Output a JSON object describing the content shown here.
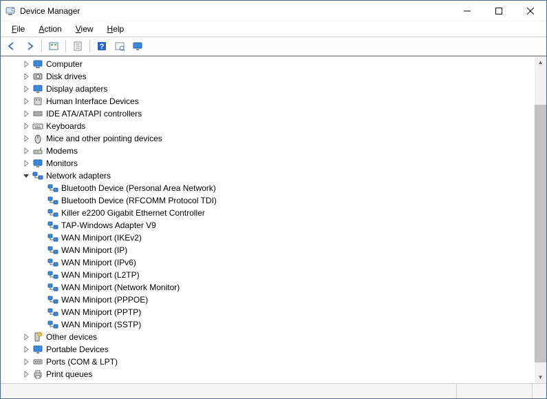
{
  "window": {
    "title": "Device Manager"
  },
  "menubar": {
    "file": {
      "label": "File",
      "accel": "F"
    },
    "action": {
      "label": "Action",
      "accel": "A"
    },
    "view": {
      "label": "View",
      "accel": "V"
    },
    "help": {
      "label": "Help",
      "accel": "H"
    }
  },
  "toolbar": {
    "back": "back-icon",
    "forward": "forward-icon",
    "show_hidden": "show-hidden-icon",
    "properties": "properties-icon",
    "help": "help-icon",
    "scan": "scan-icon",
    "monitor": "monitor-icon"
  },
  "tree": {
    "categories": [
      {
        "id": "computer",
        "label": "Computer",
        "expanded": false,
        "svg": "computer"
      },
      {
        "id": "disk-drives",
        "label": "Disk drives",
        "expanded": false,
        "svg": "disk"
      },
      {
        "id": "display-adapters",
        "label": "Display adapters",
        "expanded": false,
        "svg": "display"
      },
      {
        "id": "hid",
        "label": "Human Interface Devices",
        "expanded": false,
        "svg": "hid"
      },
      {
        "id": "ide",
        "label": "IDE ATA/ATAPI controllers",
        "expanded": false,
        "svg": "ide"
      },
      {
        "id": "keyboards",
        "label": "Keyboards",
        "expanded": false,
        "svg": "keyboard"
      },
      {
        "id": "mice",
        "label": "Mice and other pointing devices",
        "expanded": false,
        "svg": "mouse"
      },
      {
        "id": "modems",
        "label": "Modems",
        "expanded": false,
        "svg": "modem"
      },
      {
        "id": "monitors",
        "label": "Monitors",
        "expanded": false,
        "svg": "monitor"
      },
      {
        "id": "network",
        "label": "Network adapters",
        "expanded": true,
        "svg": "network",
        "children": [
          {
            "label": "Bluetooth Device (Personal Area Network)"
          },
          {
            "label": "Bluetooth Device (RFCOMM Protocol TDI)"
          },
          {
            "label": "Killer e2200 Gigabit Ethernet Controller"
          },
          {
            "label": "TAP-Windows Adapter V9"
          },
          {
            "label": "WAN Miniport (IKEv2)"
          },
          {
            "label": "WAN Miniport (IP)"
          },
          {
            "label": "WAN Miniport (IPv6)"
          },
          {
            "label": "WAN Miniport (L2TP)"
          },
          {
            "label": "WAN Miniport (Network Monitor)"
          },
          {
            "label": "WAN Miniport (PPPOE)"
          },
          {
            "label": "WAN Miniport (PPTP)"
          },
          {
            "label": "WAN Miniport (SSTP)"
          }
        ]
      },
      {
        "id": "other",
        "label": "Other devices",
        "expanded": false,
        "svg": "other"
      },
      {
        "id": "portable",
        "label": "Portable Devices",
        "expanded": false,
        "svg": "portable"
      },
      {
        "id": "ports",
        "label": "Ports (COM & LPT)",
        "expanded": false,
        "svg": "ports"
      },
      {
        "id": "print-queues",
        "label": "Print queues",
        "expanded": false,
        "svg": "printer"
      }
    ]
  },
  "scrollbar": {
    "thumb_top_pct": 12,
    "thumb_height_pct": 85
  }
}
